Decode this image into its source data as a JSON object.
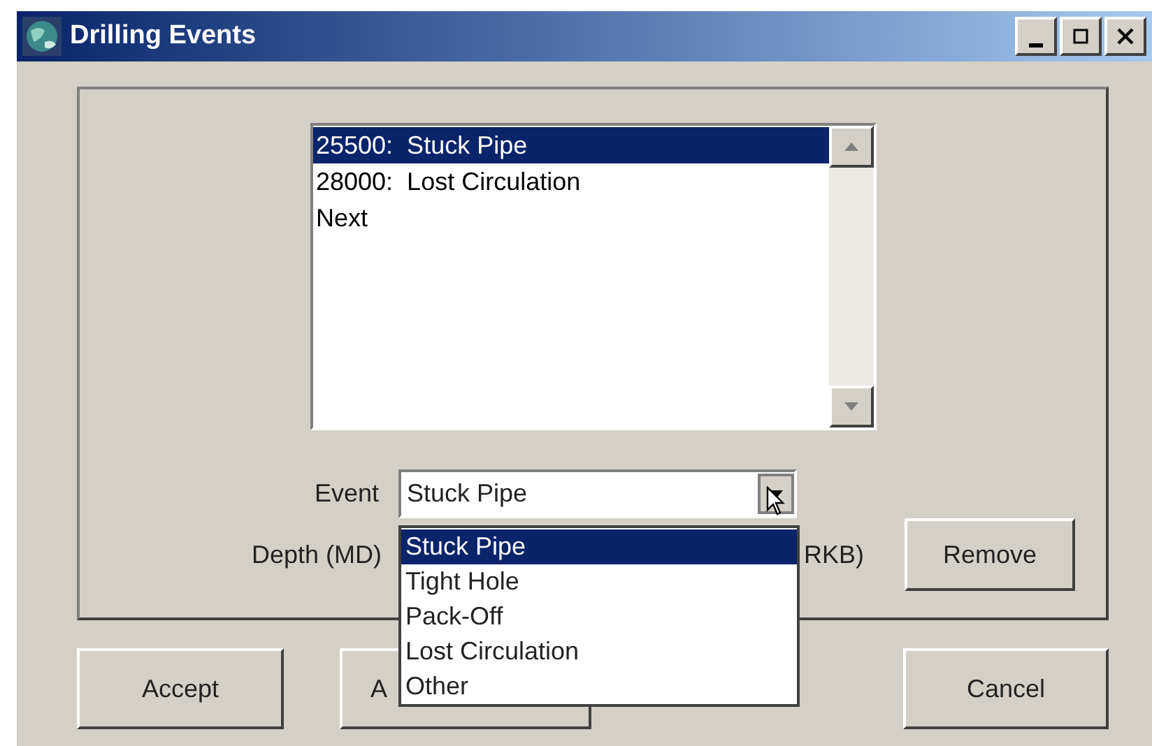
{
  "window": {
    "title": "Drilling Events"
  },
  "event_list": [
    {
      "label": "25500:  Stuck Pipe",
      "selected": true
    },
    {
      "label": "28000:  Lost Circulation",
      "selected": false
    },
    {
      "label": "Next",
      "selected": false
    }
  ],
  "event": {
    "label": "Event",
    "value": "Stuck Pipe",
    "expanded": true,
    "options": [
      {
        "label": "Stuck Pipe",
        "selected": true
      },
      {
        "label": "Tight Hole",
        "selected": false
      },
      {
        "label": "Pack-Off",
        "selected": false
      },
      {
        "label": "Lost Circulation",
        "selected": false
      },
      {
        "label": "Other",
        "selected": false
      }
    ]
  },
  "depth": {
    "label": "Depth (MD)",
    "units": "RKB)"
  },
  "remove_button": "Remove",
  "buttons": [
    {
      "label": "Accept"
    },
    {
      "label": "A"
    },
    {
      "label": "Cancel"
    }
  ]
}
